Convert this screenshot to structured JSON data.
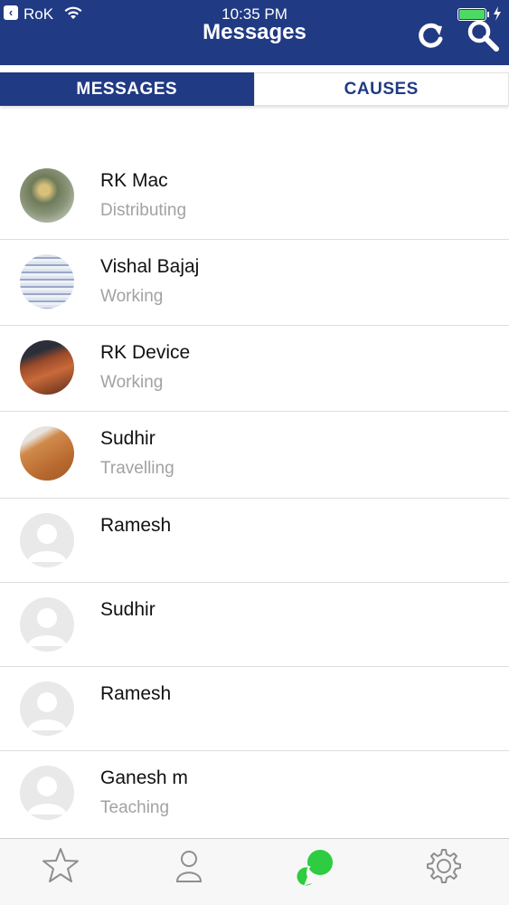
{
  "status_bar": {
    "carrier": "RoK",
    "time": "10:35 PM",
    "battery_color": "#4cd964"
  },
  "header": {
    "title": "Messages",
    "background": "#213a84",
    "actions": [
      "refresh-icon",
      "search-icon"
    ]
  },
  "tabs": [
    {
      "label": "MESSAGES",
      "active": true
    },
    {
      "label": "CAUSES",
      "active": false
    }
  ],
  "contacts": [
    {
      "name": "RK Mac",
      "status": "Distributing",
      "avatar": "photo"
    },
    {
      "name": "Vishal Bajaj",
      "status": "Working",
      "avatar": "photo"
    },
    {
      "name": "RK Device",
      "status": "Working",
      "avatar": "photo"
    },
    {
      "name": "Sudhir",
      "status": "Travelling",
      "avatar": "photo"
    },
    {
      "name": "Ramesh",
      "status": "",
      "avatar": "placeholder"
    },
    {
      "name": "Sudhir",
      "status": "",
      "avatar": "placeholder"
    },
    {
      "name": "Ramesh",
      "status": "",
      "avatar": "placeholder"
    },
    {
      "name": "Ganesh m",
      "status": "Teaching",
      "avatar": "placeholder"
    }
  ],
  "tab_bar": {
    "items": [
      "star-icon",
      "profile-icon",
      "chat-icon",
      "gear-icon"
    ],
    "active_color": "#2ecc40",
    "inactive_color": "#8e8e8e"
  }
}
